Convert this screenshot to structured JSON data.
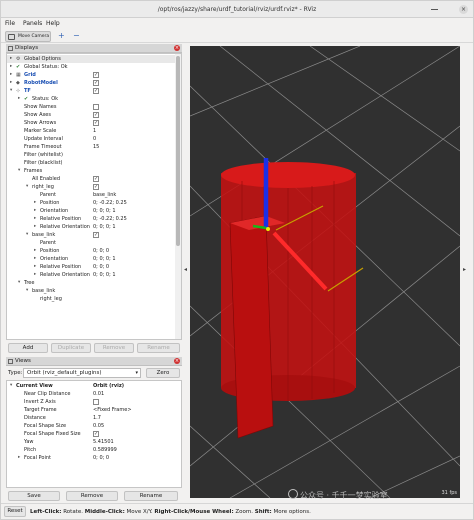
{
  "window": {
    "title": "/opt/ros/jazzy/share/urdf_tutorial/rviz/urdf.rviz* - RViz",
    "close_glyph": "×",
    "minimize_icon": "minimize-icon"
  },
  "menu": {
    "file": "File",
    "panels": "Panels",
    "help": "Help"
  },
  "toolbar": {
    "move_camera": "Move Camera",
    "plus": "+",
    "minus": "−"
  },
  "displays": {
    "header": "Displays",
    "rows": [
      {
        "label": "Global Options",
        "arrow": "▸",
        "icon": "gear-icon",
        "depth": 0
      },
      {
        "label": "Global Status: Ok",
        "arrow": "▸",
        "icon": "check-icon",
        "depth": 0
      },
      {
        "label": "Grid",
        "arrow": "▸",
        "icon": "grid-icon",
        "depth": 0,
        "blue": true,
        "check": "✓"
      },
      {
        "label": "RobotModel",
        "arrow": "▸",
        "icon": "robot-icon",
        "depth": 0,
        "blue": true,
        "check": "✓"
      },
      {
        "label": "TF",
        "arrow": "▾",
        "icon": "tf-icon",
        "depth": 0,
        "blue": true,
        "check": "✓"
      },
      {
        "label": "Status: Ok",
        "arrow": "▸",
        "icon": "check-icon",
        "depth": 1
      },
      {
        "label": "Show Names",
        "depth": 1,
        "check": ""
      },
      {
        "label": "Show Axes",
        "depth": 1,
        "check": "✓"
      },
      {
        "label": "Show Arrows",
        "depth": 1,
        "check": "✓"
      },
      {
        "label": "Marker Scale",
        "depth": 1,
        "value": "1"
      },
      {
        "label": "Update Interval",
        "depth": 1,
        "value": "0"
      },
      {
        "label": "Frame Timeout",
        "depth": 1,
        "value": "15"
      },
      {
        "label": "Filter (whitelist)",
        "depth": 1,
        "value": ""
      },
      {
        "label": "Filter (blacklist)",
        "depth": 1,
        "value": ""
      },
      {
        "label": "Frames",
        "arrow": "▾",
        "depth": 1
      },
      {
        "label": "All Enabled",
        "depth": 2,
        "check": "✓"
      },
      {
        "label": "right_leg",
        "arrow": "▾",
        "depth": 2,
        "check": "✓"
      },
      {
        "label": "Parent",
        "depth": 3,
        "value": "base_link"
      },
      {
        "label": "Position",
        "arrow": "▸",
        "depth": 3,
        "value": "0; -0.22; 0.25"
      },
      {
        "label": "Orientation",
        "arrow": "▸",
        "depth": 3,
        "value": "0; 0; 0; 1"
      },
      {
        "label": "Relative Position",
        "arrow": "▸",
        "depth": 3,
        "value": "0; -0.22; 0.25"
      },
      {
        "label": "Relative Orientation",
        "arrow": "▸",
        "depth": 3,
        "value": "0; 0; 0; 1"
      },
      {
        "label": "base_link",
        "arrow": "▾",
        "depth": 2,
        "check": "✓"
      },
      {
        "label": "Parent",
        "depth": 3,
        "value": ""
      },
      {
        "label": "Position",
        "arrow": "▸",
        "depth": 3,
        "value": "0; 0; 0"
      },
      {
        "label": "Orientation",
        "arrow": "▸",
        "depth": 3,
        "value": "0; 0; 0; 1"
      },
      {
        "label": "Relative Position",
        "arrow": "▸",
        "depth": 3,
        "value": "0; 0; 0"
      },
      {
        "label": "Relative Orientation",
        "arrow": "▸",
        "depth": 3,
        "value": "0; 0; 0; 1"
      },
      {
        "label": "Tree",
        "arrow": "▾",
        "depth": 1
      },
      {
        "label": "base_link",
        "arrow": "▾",
        "depth": 2
      },
      {
        "label": "right_leg",
        "depth": 3
      }
    ],
    "buttons": {
      "add": "Add",
      "duplicate": "Duplicate",
      "remove": "Remove",
      "rename": "Rename"
    }
  },
  "views": {
    "header": "Views",
    "type_label": "Type:",
    "type_value": "Orbit (rviz_default_plugins)",
    "zero": "Zero",
    "rows": [
      {
        "label": "Current View",
        "arrow": "▾",
        "value": "Orbit (rviz)",
        "depth": 0,
        "bold": true
      },
      {
        "label": "Near Clip Distance",
        "value": "0.01",
        "depth": 1
      },
      {
        "label": "Invert Z Axis",
        "check": "",
        "depth": 1
      },
      {
        "label": "Target Frame",
        "value": "<Fixed Frame>",
        "depth": 1
      },
      {
        "label": "Distance",
        "value": "1.7",
        "depth": 1
      },
      {
        "label": "Focal Shape Size",
        "value": "0.05",
        "depth": 1
      },
      {
        "label": "Focal Shape Fixed Size",
        "check": "✓",
        "depth": 1
      },
      {
        "label": "Yaw",
        "value": "5.41501",
        "depth": 1
      },
      {
        "label": "Pitch",
        "value": "0.589999",
        "depth": 1
      },
      {
        "label": "Focal Point",
        "arrow": "▸",
        "value": "0; 0; 0",
        "depth": 1
      }
    ],
    "buttons": {
      "save": "Save",
      "remove": "Remove",
      "rename": "Rename"
    }
  },
  "viewport": {
    "fps": "31 fps"
  },
  "status": {
    "reset": "Reset",
    "parts": [
      {
        "text": "Left-Click:",
        "bold": true
      },
      {
        "text": " Rotate. ",
        "bold": false
      },
      {
        "text": "Middle-Click:",
        "bold": true
      },
      {
        "text": " Move X/Y. ",
        "bold": false
      },
      {
        "text": "Right-Click/Mouse Wheel:",
        "bold": true
      },
      {
        "text": " Zoom. ",
        "bold": false
      },
      {
        "text": "Shift:",
        "bold": true
      },
      {
        "text": " More options.",
        "bold": false
      }
    ]
  },
  "watermark": "公众号 · 千千一梦实验室",
  "colors": {
    "robot": "#c41111",
    "viewport": "#303030",
    "grid": "#8a8a8a",
    "link_blue": "#1a4fb3"
  }
}
